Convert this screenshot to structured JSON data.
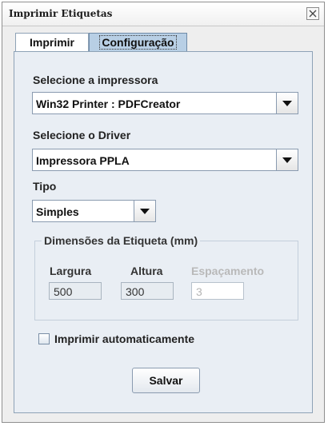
{
  "window": {
    "title": "Imprimir Etiquetas"
  },
  "tabs": [
    {
      "label": "Imprimir"
    },
    {
      "label": "Configuração"
    }
  ],
  "printer": {
    "label": "Selecione a impressora",
    "value": "Win32 Printer : PDFCreator"
  },
  "driver": {
    "label": "Selecione o Driver",
    "value": "Impressora PPLA"
  },
  "tipo": {
    "label": "Tipo",
    "value": "Simples"
  },
  "dimensions": {
    "title": "Dimensões da Etiqueta (mm)",
    "largura": {
      "label": "Largura",
      "value": "500"
    },
    "altura": {
      "label": "Altura",
      "value": "300"
    },
    "espacamento": {
      "label": "Espaçamento",
      "value": "3"
    }
  },
  "auto_print": {
    "label": "Imprimir automaticamente",
    "checked": false
  },
  "save_button": {
    "label": "Salvar"
  },
  "icons": {
    "close": "close-icon",
    "dropdown": "chevron-down-icon"
  }
}
